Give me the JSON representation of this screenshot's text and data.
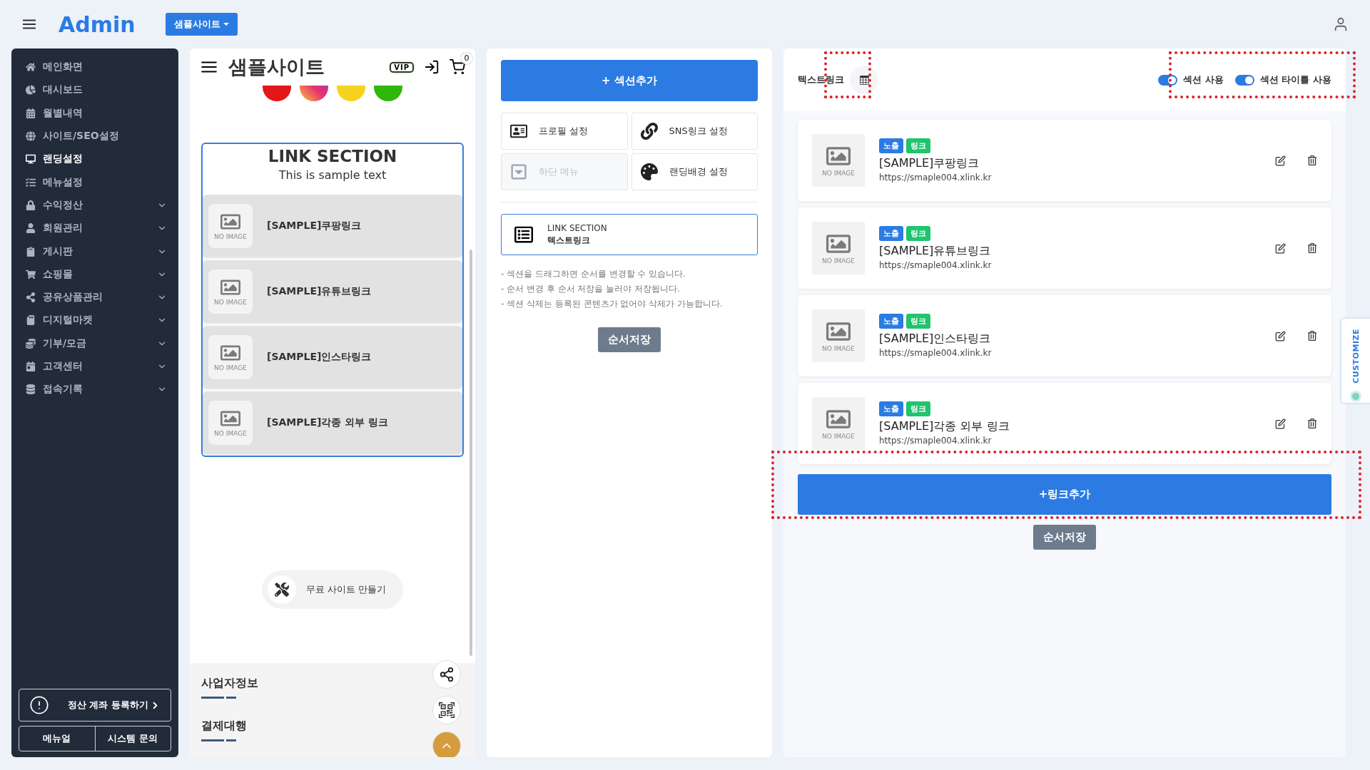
{
  "topbar": {
    "brand": "Admin",
    "site_selector": "샘플사이트"
  },
  "sidebar": {
    "items": [
      {
        "label": "메인화면",
        "selected": false,
        "has_submenu": false
      },
      {
        "label": "대시보드",
        "selected": false,
        "has_submenu": false
      },
      {
        "label": "월별내역",
        "selected": false,
        "has_submenu": false
      },
      {
        "label": "사이트/SEO설정",
        "selected": false,
        "has_submenu": false
      },
      {
        "label": "랜딩설정",
        "selected": true,
        "has_submenu": false
      },
      {
        "label": "메뉴설정",
        "selected": false,
        "has_submenu": false
      },
      {
        "label": "수익정산",
        "selected": false,
        "has_submenu": true
      },
      {
        "label": "회원관리",
        "selected": false,
        "has_submenu": true
      },
      {
        "label": "게시판",
        "selected": false,
        "has_submenu": true
      },
      {
        "label": "쇼핑몰",
        "selected": false,
        "has_submenu": true
      },
      {
        "label": "공유상품관리",
        "selected": false,
        "has_submenu": true
      },
      {
        "label": "디지털마켓",
        "selected": false,
        "has_submenu": true
      },
      {
        "label": "기부/모금",
        "selected": false,
        "has_submenu": true
      },
      {
        "label": "고객센터",
        "selected": false,
        "has_submenu": true
      },
      {
        "label": "접속기록",
        "selected": false,
        "has_submenu": true
      }
    ],
    "account_button": "정산 계좌 등록하기",
    "footer_buttons": [
      "메뉴얼",
      "시스템 문의"
    ]
  },
  "preview": {
    "title": "샘플사이트",
    "badge": "VIP",
    "cart_count": "0",
    "section": {
      "title": "LINK SECTION",
      "subtitle": "This is sample text",
      "links": [
        {
          "label": "[SAMPLE]쿠팡링크",
          "thumbnail_text": "NO IMAGE"
        },
        {
          "label": "[SAMPLE]유튜브링크",
          "thumbnail_text": "NO IMAGE"
        },
        {
          "label": "[SAMPLE]인스타링크",
          "thumbnail_text": "NO IMAGE"
        },
        {
          "label": "[SAMPLE]각종 외부 링크",
          "thumbnail_text": "NO IMAGE"
        }
      ]
    },
    "make_site_button": "무료 사이트 만들기",
    "footer_sections": [
      "사업자정보",
      "결제대행"
    ]
  },
  "section_editor": {
    "add_button": "+ 섹션추가",
    "settings": [
      {
        "label": "프로필 설정",
        "disabled": false
      },
      {
        "label": "SNS링크 설정",
        "disabled": false
      },
      {
        "label": "하단 메뉴",
        "disabled": true
      },
      {
        "label": "랜딩배경 설정",
        "disabled": false
      }
    ],
    "sections": [
      {
        "type_label": "LINK SECTION",
        "name": "텍스트링크",
        "selected": true
      }
    ],
    "notes": [
      "- 섹션을 드래그하면 순서를 변경할 수 있습니다.",
      "- 순서 변경 후 순서 저장을 눌러야 저장됩니다.",
      "- 섹션 삭제는 등록된 콘텐츠가 없어야 삭제가 가능합니다."
    ],
    "save_button": "순서저장"
  },
  "link_editor": {
    "title": "텍스트링크",
    "toggles": [
      {
        "label": "섹션 사용",
        "on": true
      },
      {
        "label": "섹션 타이틀 사용",
        "on": true
      }
    ],
    "links": [
      {
        "title": "[SAMPLE]쿠팡링크",
        "url": "https://smaple004.xlink.kr",
        "thumbnail_text": "NO IMAGE",
        "badges": [
          {
            "label": "노출",
            "color": "#2b7be3"
          },
          {
            "label": "링크",
            "color": "#20c46c"
          }
        ]
      },
      {
        "title": "[SAMPLE]유튜브링크",
        "url": "https://smaple004.xlink.kr",
        "thumbnail_text": "NO IMAGE",
        "badges": [
          {
            "label": "노출",
            "color": "#2b7be3"
          },
          {
            "label": "링크",
            "color": "#20c46c"
          }
        ]
      },
      {
        "title": "[SAMPLE]인스타링크",
        "url": "https://smaple004.xlink.kr",
        "thumbnail_text": "NO IMAGE",
        "badges": [
          {
            "label": "노출",
            "color": "#2b7be3"
          },
          {
            "label": "링크",
            "color": "#20c46c"
          }
        ]
      },
      {
        "title": "[SAMPLE]각종 외부 링크",
        "url": "https://smaple004.xlink.kr",
        "thumbnail_text": "NO IMAGE",
        "badges": [
          {
            "label": "노출",
            "color": "#2b7be3"
          },
          {
            "label": "링크",
            "color": "#20c46c"
          }
        ]
      }
    ],
    "add_button": "+링크추가",
    "save_button": "순서저장"
  },
  "customize_tab": "CUSTOMIZE"
}
